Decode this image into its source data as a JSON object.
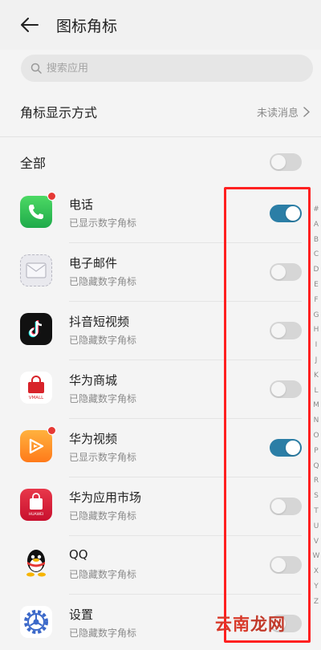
{
  "header": {
    "back_icon": "back-arrow-icon",
    "title": "图标角标"
  },
  "search": {
    "placeholder": "搜索应用",
    "icon": "search-icon"
  },
  "badge_mode": {
    "label": "角标显示方式",
    "value": "未读消息"
  },
  "all_toggle": {
    "label": "全部",
    "on": false
  },
  "apps": [
    {
      "name": "电话",
      "status": "已显示数字角标",
      "on": true,
      "icon": "phone-icon",
      "has_badge": true
    },
    {
      "name": "电子邮件",
      "status": "已隐藏数字角标",
      "on": false,
      "icon": "email-icon",
      "has_badge": false
    },
    {
      "name": "抖音短视频",
      "status": "已隐藏数字角标",
      "on": false,
      "icon": "tiktok-icon",
      "has_badge": false
    },
    {
      "name": "华为商城",
      "status": "已隐藏数字角标",
      "on": false,
      "icon": "vmall-icon",
      "has_badge": false,
      "icon_text": "VMALL"
    },
    {
      "name": "华为视频",
      "status": "已显示数字角标",
      "on": true,
      "icon": "video-play-icon",
      "has_badge": true
    },
    {
      "name": "华为应用市场",
      "status": "已隐藏数字角标",
      "on": false,
      "icon": "appgallery-icon",
      "has_badge": false,
      "icon_text": "HUAWEI"
    },
    {
      "name": "QQ",
      "status": "已隐藏数字角标",
      "on": false,
      "icon": "qq-penguin-icon",
      "has_badge": false
    },
    {
      "name": "设置",
      "status": "已隐藏数字角标",
      "on": false,
      "icon": "settings-gear-icon",
      "has_badge": false
    }
  ],
  "alpha_index": [
    "#",
    "A",
    "B",
    "C",
    "D",
    "E",
    "F",
    "G",
    "H",
    "I",
    "J",
    "K",
    "L",
    "M",
    "N",
    "O",
    "P",
    "Q",
    "R",
    "S",
    "T",
    "U",
    "V",
    "W",
    "X",
    "Y",
    "Z"
  ],
  "watermark": {
    "part1": "云南",
    "part2": "龙网"
  },
  "colors": {
    "toggle_on": "#2b7ea6",
    "toggle_off": "#d6d6d6",
    "highlight": "#ff2020",
    "badge_dot": "#e53935"
  }
}
